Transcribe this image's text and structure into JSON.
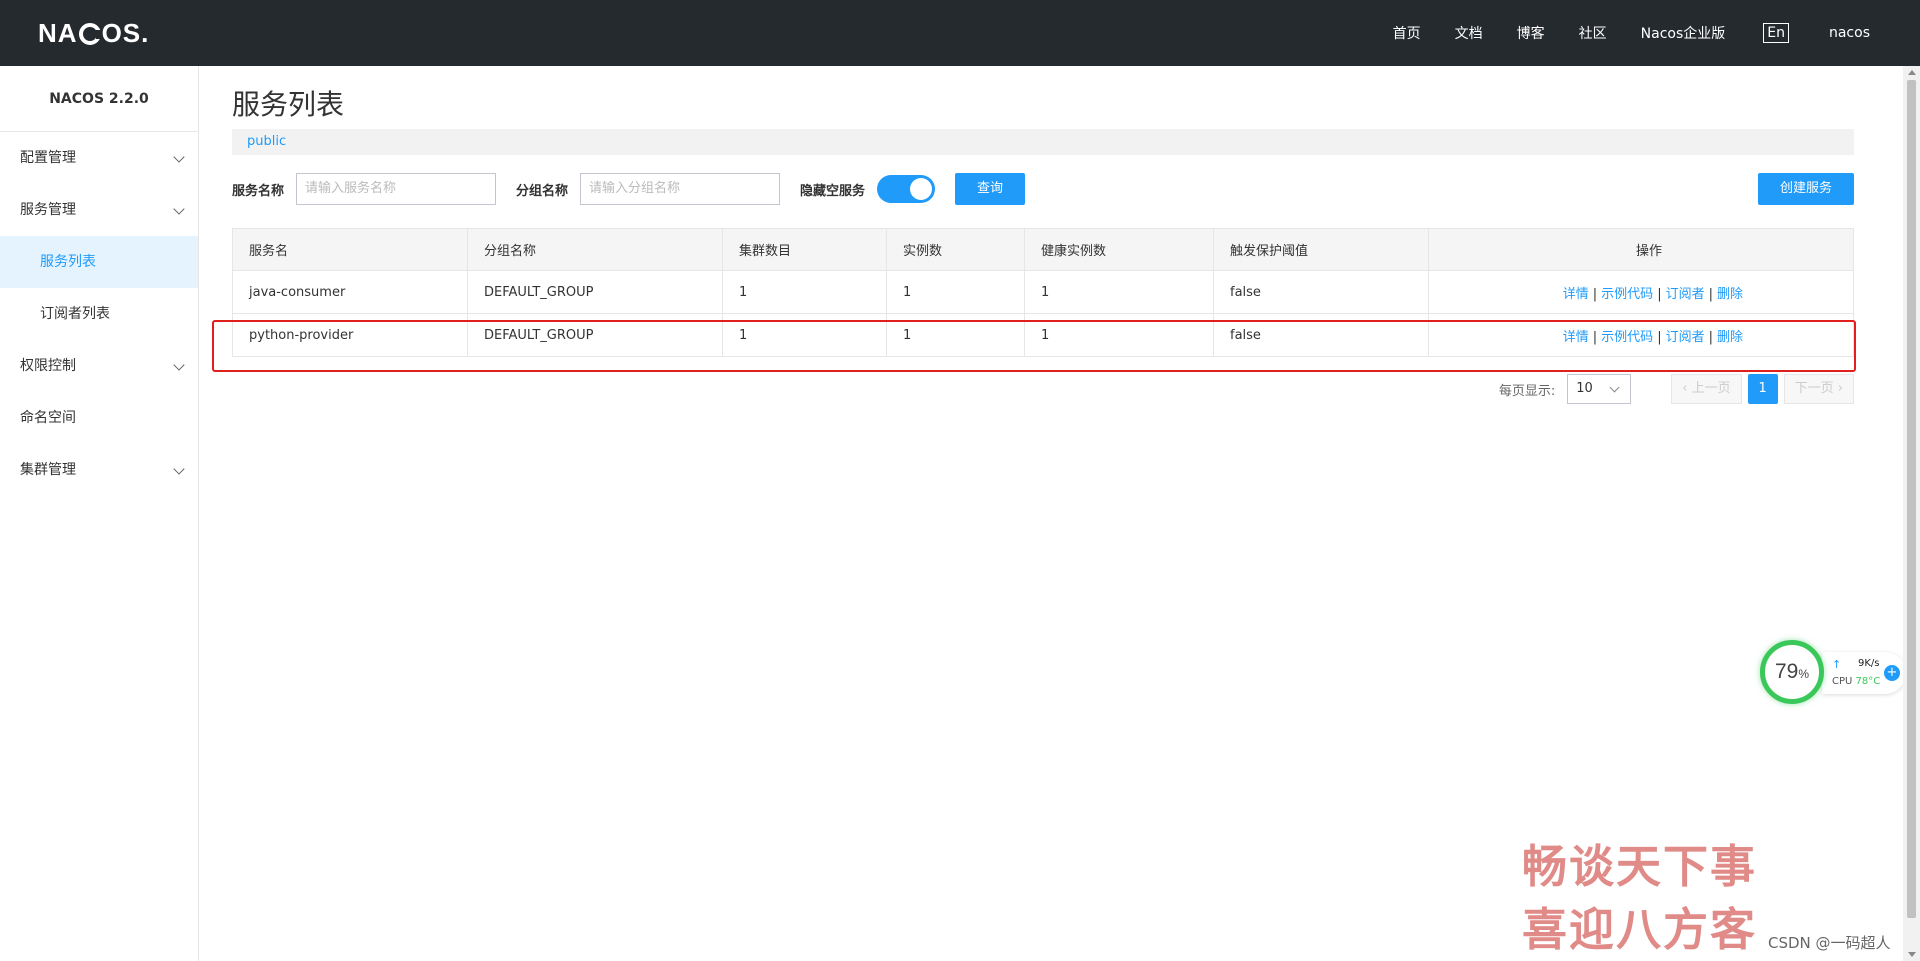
{
  "topbar": {
    "logo": "NACOS.",
    "nav": [
      "首页",
      "文档",
      "博客",
      "社区",
      "Nacos企业版"
    ],
    "lang": "En",
    "user": "nacos"
  },
  "sidebar": {
    "version": "NACOS 2.2.0",
    "items": [
      {
        "label": "配置管理"
      },
      {
        "label": "服务管理"
      },
      {
        "label": "服务列表"
      },
      {
        "label": "订阅者列表"
      },
      {
        "label": "权限控制"
      },
      {
        "label": "命名空间"
      },
      {
        "label": "集群管理"
      }
    ]
  },
  "main": {
    "title": "服务列表",
    "namespace": "public",
    "filter": {
      "service_label": "服务名称",
      "service_placeholder": "请输入服务名称",
      "group_label": "分组名称",
      "group_placeholder": "请输入分组名称",
      "hide_empty_label": "隐藏空服务",
      "query_button": "查询",
      "create_button": "创建服务"
    },
    "table": {
      "headers": [
        "服务名",
        "分组名称",
        "集群数目",
        "实例数",
        "健康实例数",
        "触发保护阈值",
        "操作"
      ],
      "rows": [
        [
          "java-consumer",
          "DEFAULT_GROUP",
          "1",
          "1",
          "1",
          "false"
        ],
        [
          "python-provider",
          "DEFAULT_GROUP",
          "1",
          "1",
          "1",
          "false"
        ]
      ],
      "ops": [
        "详情",
        "示例代码",
        "订阅者",
        "删除"
      ]
    },
    "pager": {
      "per_page_label": "每页显示:",
      "per_page": "10",
      "prev": "上一页",
      "current": "1",
      "next": "下一页"
    }
  },
  "widget": {
    "percent": "79",
    "percent_unit": "%",
    "speed": "9K/s",
    "cpu_label": "CPU",
    "cpu_temp": "78°C"
  },
  "watermark": {
    "line1": "畅谈天下事",
    "line2": "喜迎八方客",
    "credit": "CSDN @一码超人"
  },
  "colors": {
    "topbar": "#252a2f",
    "accent": "#209bfa",
    "highlight": "#e0201d"
  }
}
